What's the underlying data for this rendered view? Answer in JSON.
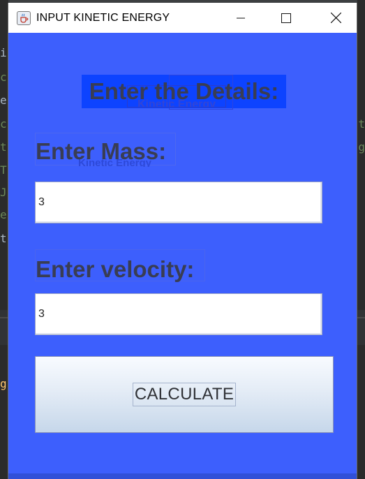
{
  "background": {
    "left_chars": [
      "i",
      "c",
      "e",
      "c",
      "t",
      "T",
      "J",
      "e",
      "t",
      "g"
    ],
    "right_chars": [
      "t",
      "g"
    ]
  },
  "window": {
    "title": "INPUT KINETIC ENERGY",
    "icon": "java-coffee-icon",
    "controls": {
      "minimize": "minimize-icon",
      "maximize": "maximize-icon",
      "close": "close-icon"
    }
  },
  "form": {
    "heading": "Enter the Details:",
    "heading_ghost": "Kinetic Energy",
    "mass_label": "Enter Mass:",
    "mass_ghost": "Kinetic Energy",
    "mass_value": "3",
    "velocity_label": "Enter velocity:",
    "velocity_value": "3",
    "calculate_label": "CALCULATE"
  },
  "colors": {
    "panel_bg": "#3d5ffd",
    "heading_bg": "#0d43ff",
    "label_text": "#393d53"
  }
}
